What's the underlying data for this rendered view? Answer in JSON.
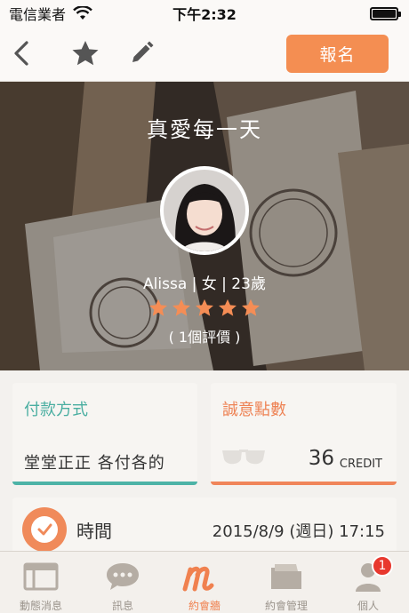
{
  "status_bar": {
    "carrier": "電信業者",
    "time": "下午2:32"
  },
  "nav": {
    "signup_label": "報名"
  },
  "event": {
    "title": "真愛每一天",
    "host": {
      "name_line": "Alissa | 女 | 23歲",
      "rating": 5,
      "review_text": "( 1個評價 )"
    }
  },
  "payment": {
    "title": "付款方式",
    "value": "堂堂正正 各付各的"
  },
  "sincerity": {
    "title": "誠意點數",
    "value": "36",
    "unit": "CREDIT"
  },
  "time": {
    "label": "時間",
    "value": "2015/8/9 (週日) 17:15"
  },
  "tab_bar": {
    "tabs": [
      {
        "label": "動態消息",
        "icon": "news-feed-icon"
      },
      {
        "label": "訊息",
        "icon": "chat-bubble-icon"
      },
      {
        "label": "約會牆",
        "icon": "m-logo-icon"
      },
      {
        "label": "約會管理",
        "icon": "folder-icon"
      },
      {
        "label": "個人",
        "icon": "person-icon"
      }
    ],
    "active_index": 2,
    "personal_badge": "1"
  },
  "colors": {
    "accent_orange": "#f48e52",
    "teal": "#4db3a7",
    "badge_red": "#e8382e"
  }
}
